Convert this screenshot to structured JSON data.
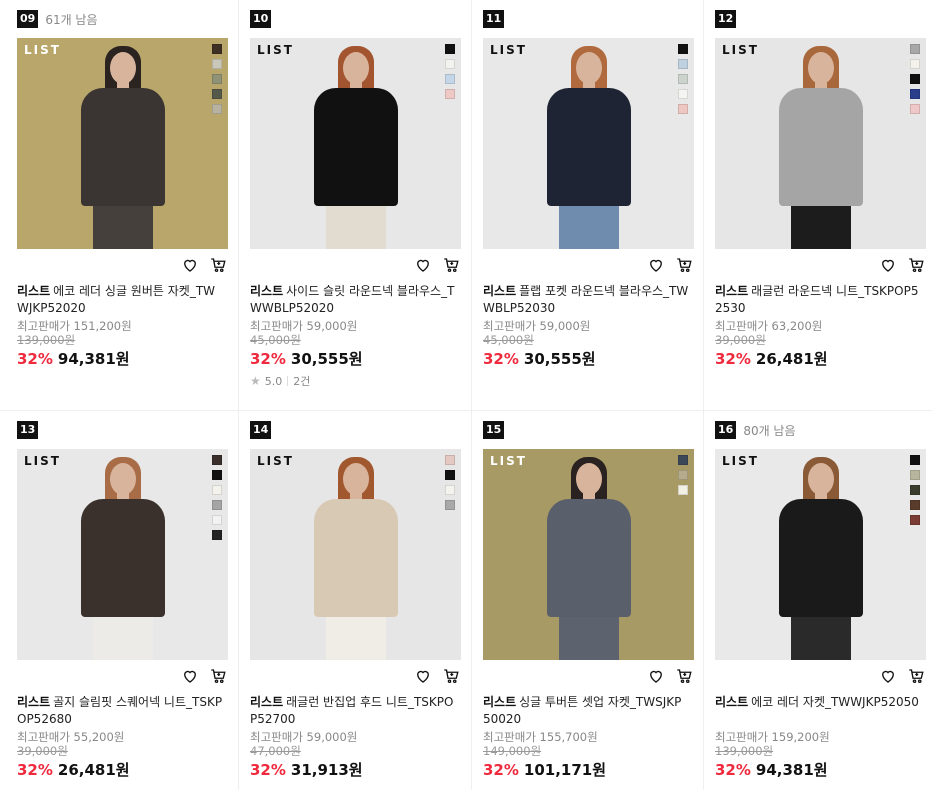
{
  "products": [
    {
      "rank": "09",
      "remain": "61개 남음",
      "brand": "리스트",
      "name": "에코 레더 싱글 원버튼 자켓_TWWJKP52020",
      "max_price": "최고판매가 151,200원",
      "original": "139,000원",
      "discount": "32%",
      "price": "94,381원",
      "rating": "",
      "reviews": "",
      "logo": "LIST",
      "swatches": [
        "#3d2f24",
        "#c9c8b8",
        "#8f9276",
        "#54594a",
        "#b8b2a0"
      ],
      "bg": "#b8a66a",
      "hair": "#2a2320",
      "top": "#3a3432",
      "legs": "#45403c"
    },
    {
      "rank": "10",
      "remain": "",
      "brand": "리스트",
      "name": "사이드 슬릿 라운드넥 블라우스_TWWBLP52020",
      "max_price": "최고판매가 59,000원",
      "original": "45,000원",
      "discount": "32%",
      "price": "30,555원",
      "rating": "5.0",
      "reviews": "2건",
      "logo": "LIST",
      "swatches": [
        "#111111",
        "#f2f2ee",
        "#c5d6e8",
        "#eec8c4"
      ],
      "bg": "#e7e7e7",
      "hair": "#a2552f",
      "top": "#111111",
      "legs": "#e2dcd0"
    },
    {
      "rank": "11",
      "remain": "",
      "brand": "리스트",
      "name": "플랩 포켓 라운드넥 블라우스_TWWBLP52030",
      "max_price": "최고판매가 59,000원",
      "original": "45,000원",
      "discount": "32%",
      "price": "30,555원",
      "rating": "",
      "reviews": "",
      "logo": "LIST",
      "swatches": [
        "#111111",
        "#bfd0e0",
        "#ccd3cc",
        "#f4f4f0",
        "#eec6c2"
      ],
      "bg": "#e8e8e8",
      "hair": "#b06a3e",
      "top": "#1e2433",
      "legs": "#6f8cae"
    },
    {
      "rank": "12",
      "remain": "",
      "brand": "리스트",
      "name": "래글런 라운드넥 니트_TSKPOP52530",
      "max_price": "최고판매가 63,200원",
      "original": "39,000원",
      "discount": "32%",
      "price": "26,481원",
      "rating": "",
      "reviews": "",
      "logo": "LIST",
      "swatches": [
        "#a8a8a8",
        "#f3f1ea",
        "#111111",
        "#2a3e8c",
        "#eec8c8"
      ],
      "bg": "#e6e6e6",
      "hair": "#a8683c",
      "top": "#a5a5a5",
      "legs": "#1c1c1c"
    },
    {
      "rank": "13",
      "remain": "",
      "brand": "리스트",
      "name": "골지 슬림핏 스퀘어넥 니트_TSKPOP52680",
      "max_price": "최고판매가 55,200원",
      "original": "39,000원",
      "discount": "32%",
      "price": "26,481원",
      "rating": "",
      "reviews": "",
      "logo": "LIST",
      "swatches": [
        "#3a2f2b",
        "#111111",
        "#f4f2ec",
        "#a5a5a5",
        "#f2f2f2",
        "#222222"
      ],
      "bg": "#e8e8e8",
      "hair": "#a86c46",
      "top": "#3a302c",
      "legs": "#ecebe8"
    },
    {
      "rank": "14",
      "remain": "",
      "brand": "리스트",
      "name": "래글런 반집업 후드 니트_TSKPOP52700",
      "max_price": "최고판매가 59,000원",
      "original": "47,000원",
      "discount": "32%",
      "price": "31,913원",
      "rating": "",
      "reviews": "",
      "logo": "LIST",
      "swatches": [
        "#e3c9c2",
        "#111111",
        "#f4f3ee",
        "#a8a8a8"
      ],
      "bg": "#e6e6e6",
      "hair": "#a2582e",
      "top": "#d8c9b4",
      "legs": "#f0ede6"
    },
    {
      "rank": "15",
      "remain": "",
      "brand": "리스트",
      "name": "싱글 투버튼 셋업 자켓_TWSJKP50020",
      "max_price": "최고판매가 155,700원",
      "original": "149,000원",
      "discount": "32%",
      "price": "101,171원",
      "rating": "",
      "reviews": "",
      "logo": "LIST",
      "swatches": [
        "#3c4757",
        "#b6ab8a",
        "#f2efe4"
      ],
      "bg": "#a89a64",
      "hair": "#2a2220",
      "top": "#5a5f6c",
      "legs": "#5d626f"
    },
    {
      "rank": "16",
      "remain": "80개 남음",
      "brand": "리스트",
      "name": "에코 레더 자켓_TWWJKP52050",
      "max_price": "최고판매가 159,200원",
      "original": "139,000원",
      "discount": "32%",
      "price": "94,381원",
      "rating": "",
      "reviews": "",
      "logo": "LIST",
      "swatches": [
        "#111111",
        "#b8b59e",
        "#3b3d2c",
        "#5a3c2c",
        "#7a3c34"
      ],
      "bg": "#e9e9e9",
      "hair": "#8a5a36",
      "top": "#1a1a1a",
      "legs": "#2a2a2a"
    }
  ]
}
